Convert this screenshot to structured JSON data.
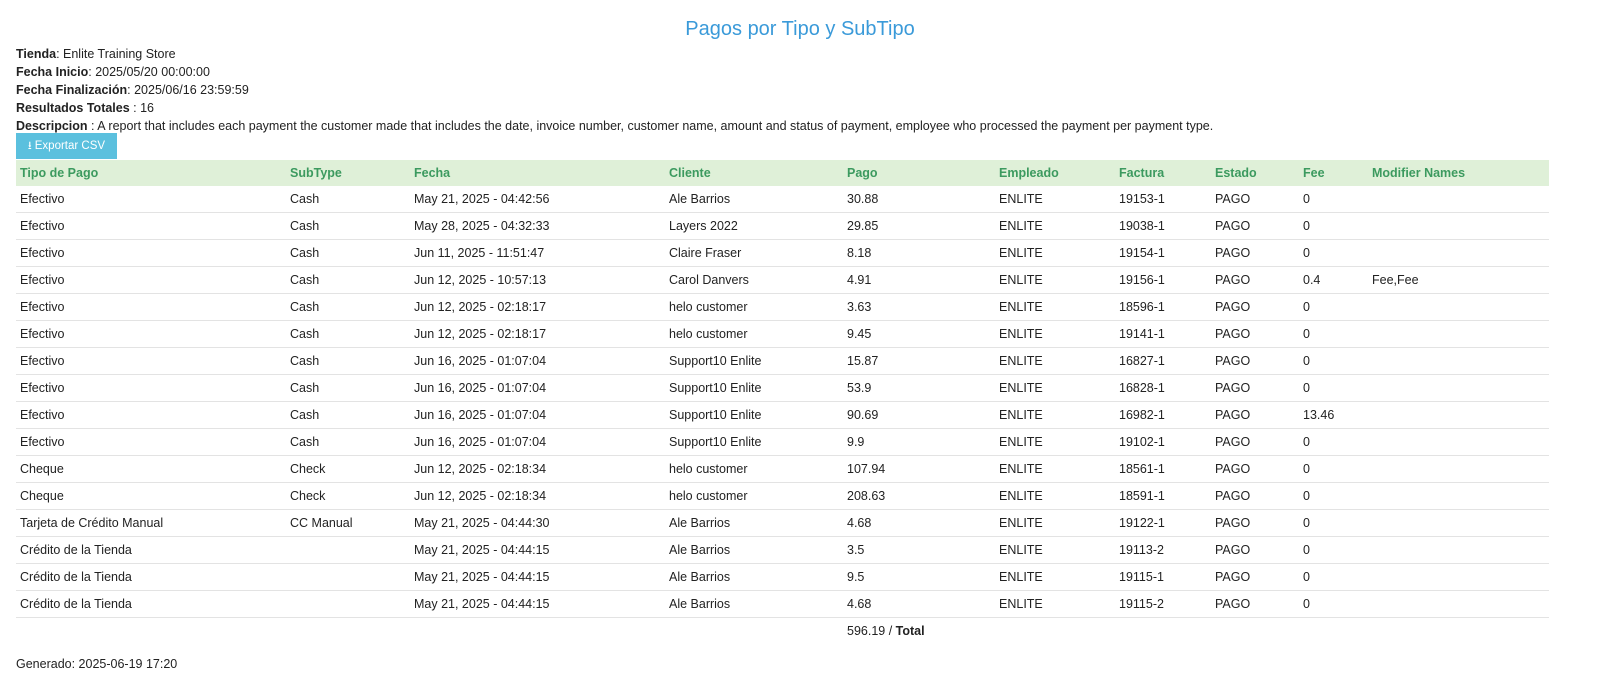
{
  "report": {
    "title": "Pagos por Tipo y SubTipo"
  },
  "meta": {
    "store_label": "Tienda",
    "store_value": "Enlite Training Store",
    "start_label": "Fecha Inicio",
    "start_value": "2025/05/20 00:00:00",
    "end_label": "Fecha Finalización",
    "end_value": "2025/06/16 23:59:59",
    "results_label": "Resultados Totales",
    "results_value": "16",
    "desc_label": "Descripcion",
    "desc_value": "A report that includes each payment the customer made that includes the date, invoice number, customer name, amount and status of payment, employee who processed the payment per payment type."
  },
  "export": {
    "label": "Exportar CSV",
    "icon": "download-icon"
  },
  "table": {
    "headers": [
      "Tipo de Pago",
      "SubType",
      "Fecha",
      "Cliente",
      "Pago",
      "Empleado",
      "Factura",
      "Estado",
      "Fee",
      "Modifier Names"
    ],
    "rows": [
      [
        "Efectivo",
        "Cash",
        "May 21, 2025 - 04:42:56",
        "Ale Barrios",
        "30.88",
        "ENLITE",
        "19153-1",
        "PAGO",
        "0",
        ""
      ],
      [
        "Efectivo",
        "Cash",
        "May 28, 2025 - 04:32:33",
        "Layers 2022",
        "29.85",
        "ENLITE",
        "19038-1",
        "PAGO",
        "0",
        ""
      ],
      [
        "Efectivo",
        "Cash",
        "Jun 11, 2025 - 11:51:47",
        "Claire Fraser",
        "8.18",
        "ENLITE",
        "19154-1",
        "PAGO",
        "0",
        ""
      ],
      [
        "Efectivo",
        "Cash",
        "Jun 12, 2025 - 10:57:13",
        "Carol Danvers",
        "4.91",
        "ENLITE",
        "19156-1",
        "PAGO",
        "0.4",
        "Fee,Fee"
      ],
      [
        "Efectivo",
        "Cash",
        "Jun 12, 2025 - 02:18:17",
        "helo customer",
        "3.63",
        "ENLITE",
        "18596-1",
        "PAGO",
        "0",
        ""
      ],
      [
        "Efectivo",
        "Cash",
        "Jun 12, 2025 - 02:18:17",
        "helo customer",
        "9.45",
        "ENLITE",
        "19141-1",
        "PAGO",
        "0",
        ""
      ],
      [
        "Efectivo",
        "Cash",
        "Jun 16, 2025 - 01:07:04",
        "Support10 Enlite",
        "15.87",
        "ENLITE",
        "16827-1",
        "PAGO",
        "0",
        ""
      ],
      [
        "Efectivo",
        "Cash",
        "Jun 16, 2025 - 01:07:04",
        "Support10 Enlite",
        "53.9",
        "ENLITE",
        "16828-1",
        "PAGO",
        "0",
        ""
      ],
      [
        "Efectivo",
        "Cash",
        "Jun 16, 2025 - 01:07:04",
        "Support10 Enlite",
        "90.69",
        "ENLITE",
        "16982-1",
        "PAGO",
        "13.46",
        ""
      ],
      [
        "Efectivo",
        "Cash",
        "Jun 16, 2025 - 01:07:04",
        "Support10 Enlite",
        "9.9",
        "ENLITE",
        "19102-1",
        "PAGO",
        "0",
        ""
      ],
      [
        "Cheque",
        "Check",
        "Jun 12, 2025 - 02:18:34",
        "helo customer",
        "107.94",
        "ENLITE",
        "18561-1",
        "PAGO",
        "0",
        ""
      ],
      [
        "Cheque",
        "Check",
        "Jun 12, 2025 - 02:18:34",
        "helo customer",
        "208.63",
        "ENLITE",
        "18591-1",
        "PAGO",
        "0",
        ""
      ],
      [
        "Tarjeta de Crédito Manual",
        "CC Manual",
        "May 21, 2025 - 04:44:30",
        "Ale Barrios",
        "4.68",
        "ENLITE",
        "19122-1",
        "PAGO",
        "0",
        ""
      ],
      [
        "Crédito de la Tienda",
        "",
        "May 21, 2025 - 04:44:15",
        "Ale Barrios",
        "3.5",
        "ENLITE",
        "19113-2",
        "PAGO",
        "0",
        ""
      ],
      [
        "Crédito de la Tienda",
        "",
        "May 21, 2025 - 04:44:15",
        "Ale Barrios",
        "9.5",
        "ENLITE",
        "19115-1",
        "PAGO",
        "0",
        ""
      ],
      [
        "Crédito de la Tienda",
        "",
        "May 21, 2025 - 04:44:15",
        "Ale Barrios",
        "4.68",
        "ENLITE",
        "19115-2",
        "PAGO",
        "0",
        ""
      ]
    ],
    "total_value": "596.19",
    "total_label": "Total"
  },
  "footer": {
    "generated": "Generado: 2025-06-19 17:20"
  },
  "colors": {
    "title": "#3a9ad9",
    "header_bg": "#dff0d8",
    "header_text": "#3c9a5f",
    "button_bg": "#5bc0de"
  }
}
